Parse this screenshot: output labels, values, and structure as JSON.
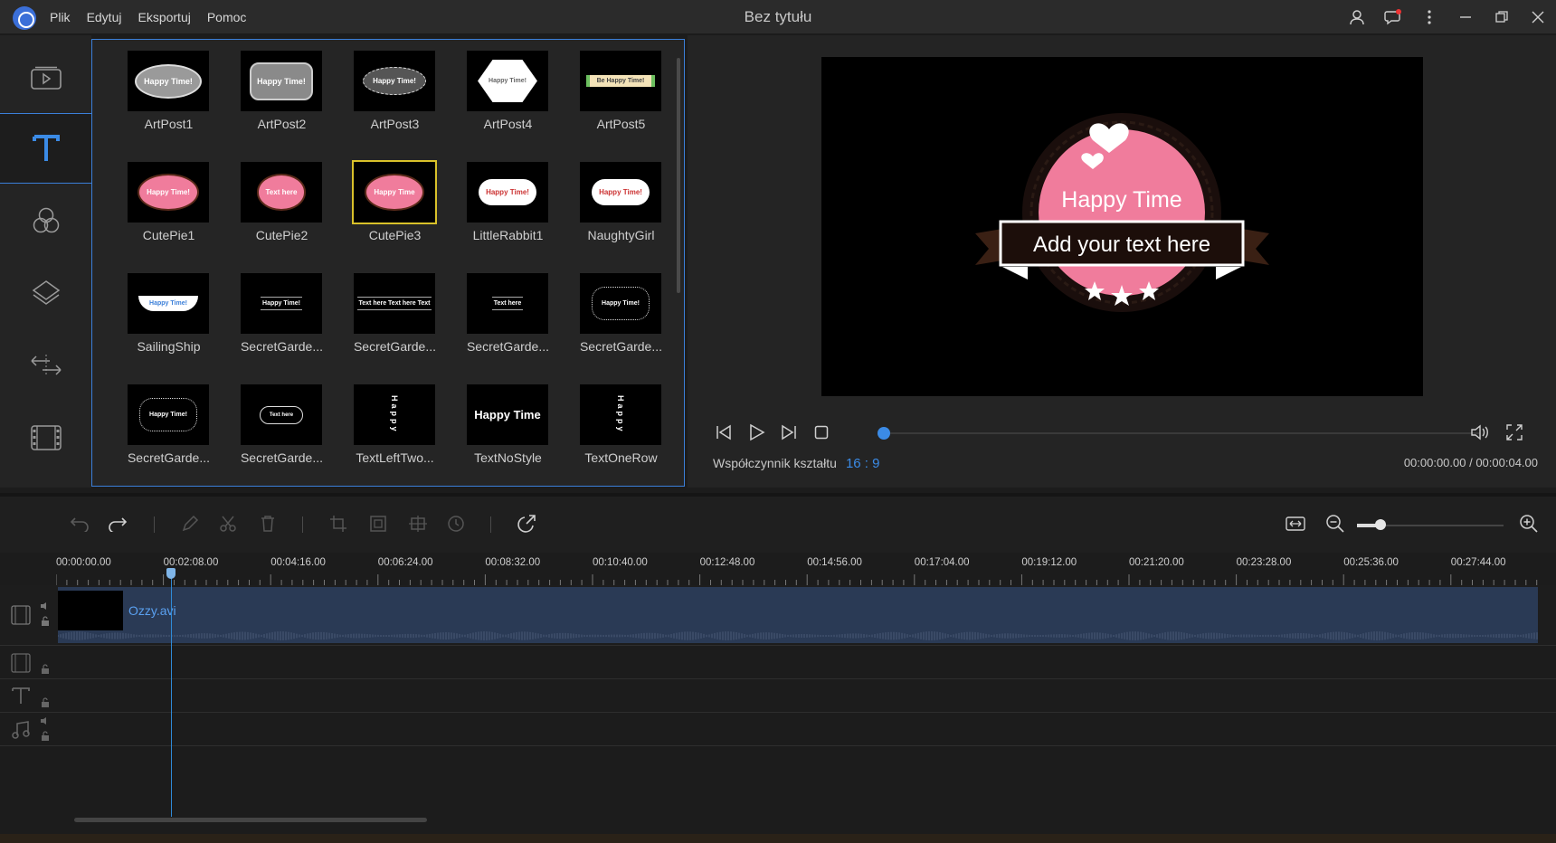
{
  "titlebar": {
    "title": "Bez tytułu",
    "menu": [
      "Plik",
      "Edytuj",
      "Eksportuj",
      "Pomoc"
    ]
  },
  "templates": [
    {
      "label": "ArtPost1",
      "thumb_text": "Happy Time!"
    },
    {
      "label": "ArtPost2",
      "thumb_text": "Happy Time!"
    },
    {
      "label": "ArtPost3",
      "thumb_text": "Happy Time!"
    },
    {
      "label": "ArtPost4",
      "thumb_text": "Happy Time!"
    },
    {
      "label": "ArtPost5",
      "thumb_text": "Be Happy Time!"
    },
    {
      "label": "CutePie1",
      "thumb_text": "Happy Time!"
    },
    {
      "label": "CutePie2",
      "thumb_text": "Text here"
    },
    {
      "label": "CutePie3",
      "thumb_text": "Happy Time"
    },
    {
      "label": "LittleRabbit1",
      "thumb_text": "Happy Time!"
    },
    {
      "label": "NaughtyGirl",
      "thumb_text": "Happy Time!"
    },
    {
      "label": "SailingShip",
      "thumb_text": "Happy Time!"
    },
    {
      "label": "SecretGarde...",
      "thumb_text": "Happy Time!"
    },
    {
      "label": "SecretGarde...",
      "thumb_text": "Text here Text here Text"
    },
    {
      "label": "SecretGarde...",
      "thumb_text": "Text here"
    },
    {
      "label": "SecretGarde...",
      "thumb_text": "Happy Time!"
    },
    {
      "label": "SecretGarde...",
      "thumb_text": "Happy Time!"
    },
    {
      "label": "SecretGarde...",
      "thumb_text": "Text here"
    },
    {
      "label": "TextLeftTwo...",
      "thumb_text": "Happy"
    },
    {
      "label": "TextNoStyle",
      "thumb_text": "Happy Time"
    },
    {
      "label": "TextOneRow",
      "thumb_text": "Happy"
    }
  ],
  "selected_template_index": 7,
  "preview": {
    "title_text": "Happy Time",
    "body_text": "Add your text here",
    "aspect_label": "Współczynnik kształtu",
    "aspect_value": "16 : 9",
    "timecode": "00:00:00.00 / 00:00:04.00",
    "progress": 0
  },
  "timeline": {
    "ruler": [
      "00:00:00.00",
      "00:02:08.00",
      "00:04:16.00",
      "00:06:24.00",
      "00:08:32.00",
      "00:10:40.00",
      "00:12:48.00",
      "00:14:56.00",
      "00:17:04.00",
      "00:19:12.00",
      "00:21:20.00",
      "00:23:28.00",
      "00:25:36.00",
      "00:27:44.00"
    ],
    "clip_name": "Ozzy.avi"
  },
  "colors": {
    "accent": "#3b8be6",
    "pink": "#f07c9c",
    "selection": "#d9c12a"
  }
}
